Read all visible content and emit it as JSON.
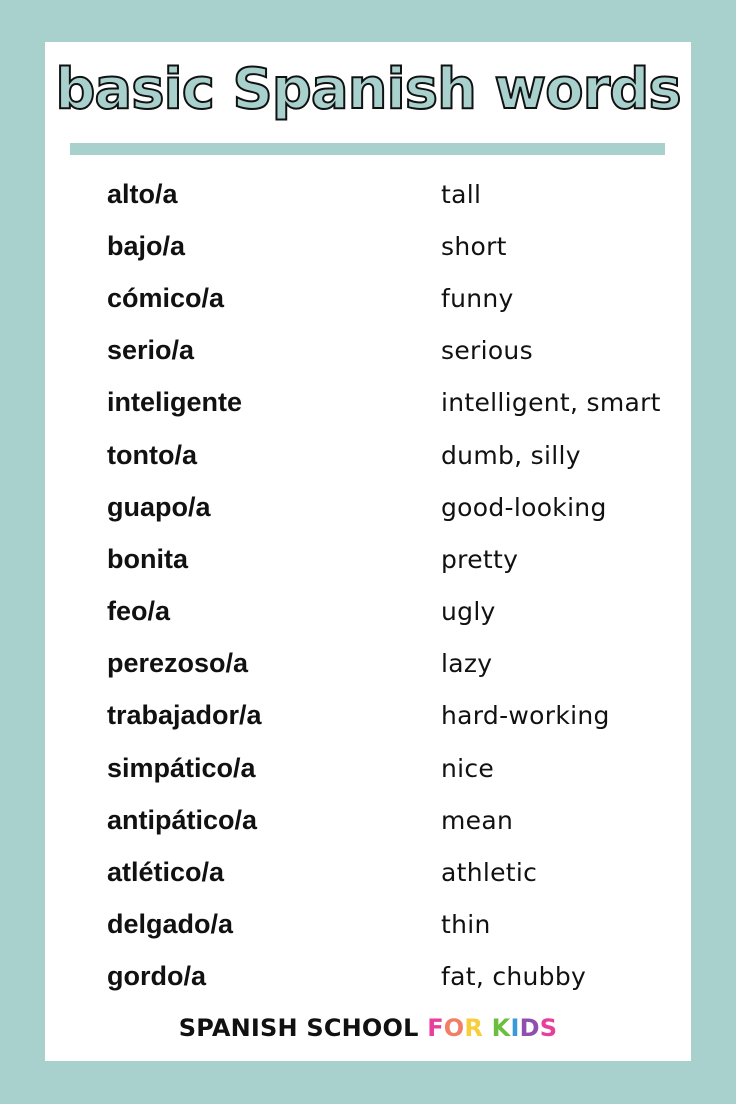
{
  "title": "basic Spanish words",
  "colors": {
    "background": "#a8d0cc",
    "card": "#ffffff",
    "text": "#111111",
    "brand_letters": [
      "#e83e9c",
      "#f27e6a",
      "#f7cf3c",
      "#6cbf3e",
      "#3a9ad9",
      "#8e4fae",
      "#e83e9c"
    ]
  },
  "words": [
    {
      "spanish": "alto/a",
      "english": "tall"
    },
    {
      "spanish": "bajo/a",
      "english": "short"
    },
    {
      "spanish": "cómico/a",
      "english": "funny"
    },
    {
      "spanish": "serio/a",
      "english": "serious"
    },
    {
      "spanish": "inteligente",
      "english": "intelligent, smart"
    },
    {
      "spanish": "tonto/a",
      "english": "dumb, silly"
    },
    {
      "spanish": "guapo/a",
      "english": "good-looking"
    },
    {
      "spanish": "bonita",
      "english": "pretty"
    },
    {
      "spanish": "feo/a",
      "english": "ugly"
    },
    {
      "spanish": "perezoso/a",
      "english": "lazy"
    },
    {
      "spanish": "trabajador/a",
      "english": "hard-working"
    },
    {
      "spanish": "simpático/a",
      "english": "nice"
    },
    {
      "spanish": "antipático/a",
      "english": "mean"
    },
    {
      "spanish": "atlético/a",
      "english": "athletic"
    },
    {
      "spanish": "delgado/a",
      "english": "thin"
    },
    {
      "spanish": "gordo/a",
      "english": "fat, chubby"
    }
  ],
  "footer": {
    "black_part": "SPANISH SCHOOL ",
    "colored_letters": [
      "F",
      "O",
      "R",
      " ",
      "K",
      "I",
      "D",
      "S"
    ]
  }
}
